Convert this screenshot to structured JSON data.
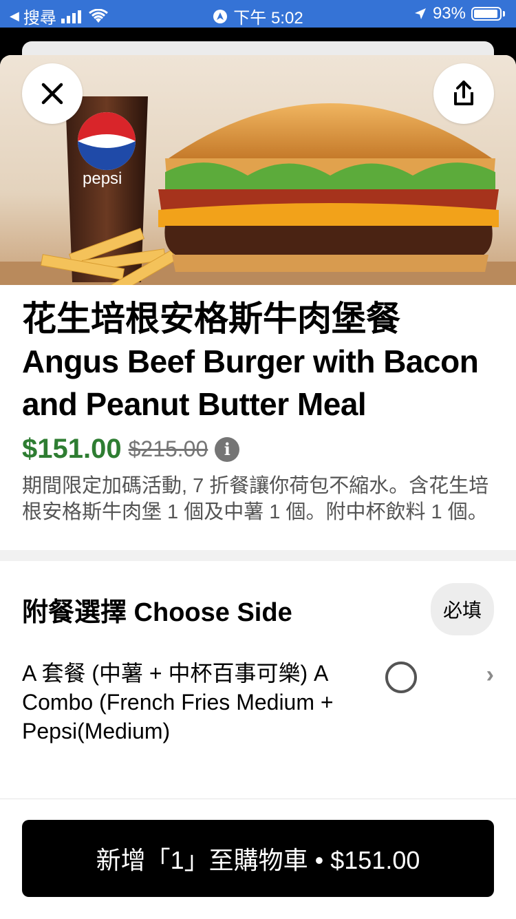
{
  "status_bar": {
    "back_app": "搜尋",
    "time": "下午 5:02",
    "battery": "93%"
  },
  "item": {
    "title_zh": "花生培根安格斯牛肉堡餐",
    "title_en": "Angus Beef Burger with Bacon and Peanut Butter Meal",
    "price": "$151.00",
    "original_price": "$215.00",
    "description": "期間限定加碼活動, 7 折餐讓你荷包不縮水。含花生培根安格斯牛肉堡 1 個及中薯 1 個。附中杯飲料 1 個。",
    "image_brand_text": "pepsi"
  },
  "section": {
    "title": "附餐選擇 Choose Side",
    "required_label": "必填"
  },
  "options": [
    {
      "label": "A 套餐 (中薯 + 中杯百事可樂) A Combo (French Fries Medium + Pepsi(Medium)"
    }
  ],
  "cart_button": {
    "label": "新增「1」至購物車 • $151.00"
  },
  "colors": {
    "status_bar": "#3573d6",
    "price_green": "#2e7d32",
    "button_black": "#000000"
  },
  "icons": [
    "back-arrow-icon",
    "signal-icon",
    "wifi-icon",
    "location-icon",
    "battery-icon",
    "close-icon",
    "share-icon",
    "info-icon",
    "radio-icon",
    "chevron-right-icon"
  ]
}
